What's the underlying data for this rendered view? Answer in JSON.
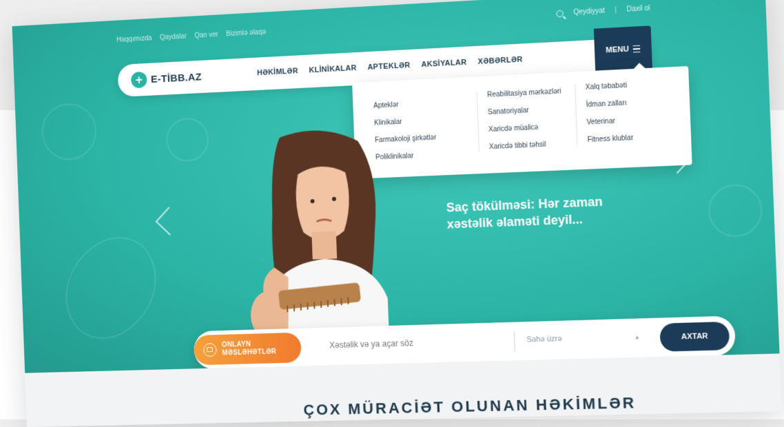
{
  "topbar": {
    "links": [
      "Haqqımızda",
      "Qaydalar",
      "Qan ver",
      "Bizimlə əlaqə"
    ],
    "register": "Qeydiyyat",
    "separator": "|",
    "login": "Daxil ol"
  },
  "logo": {
    "mark": "+",
    "text": "E-TİBB.AZ"
  },
  "nav": {
    "items": [
      "HƏKİMLƏR",
      "KLİNİKALAR",
      "APTEKLƏR",
      "AKSİYALAR",
      "XƏBƏRLƏR"
    ],
    "menu_label": "MENU"
  },
  "dropdown": {
    "col1": [
      "Apteklər",
      "Klinikalar",
      "Farmakoloji şirkətlər",
      "Poliklinikalar"
    ],
    "col2": [
      "Reabilitasiya mərkəzləri",
      "Sanatoriyalar",
      "Xaricdə müalicə",
      "Xaricdə tibbi təhsil"
    ],
    "col3": [
      "Xalq təbabəti",
      "İdman zalları",
      "Veterinar",
      "Fitness klublar"
    ]
  },
  "hero": {
    "headline_line1": "Saç tökülməsi: Hər zaman",
    "headline_line2": "xəstəlik əlaməti deyil..."
  },
  "search": {
    "consult_line1": "ONLAYN",
    "consult_line2": "MƏSLƏHƏTLƏR",
    "placeholder": "Xəstəlik və ya açar söz",
    "field_label": "Sahə üzrə",
    "button": "AXTAR"
  },
  "section": {
    "title": "ÇOX MÜRACİƏT OLUNAN HƏKİMLƏR"
  },
  "colors": {
    "teal": "#2cb5a6",
    "navy": "#1b3b58",
    "orange": "#f17b2f"
  }
}
